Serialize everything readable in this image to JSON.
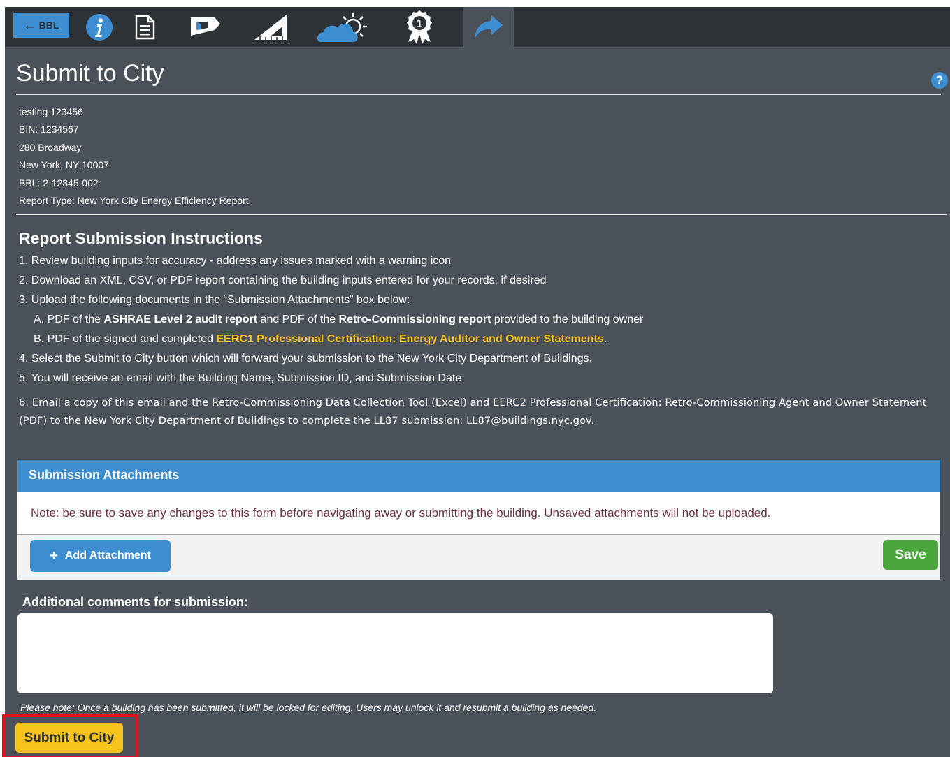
{
  "nav": {
    "back_label": "BBL",
    "icons": [
      "info-icon",
      "document-icon",
      "building-icon",
      "ruler-icon",
      "weather-icon",
      "award-icon",
      "share-icon"
    ],
    "accent_color": "#3d8ed1"
  },
  "page": {
    "title": "Submit to City",
    "help_glyph": "?"
  },
  "building": {
    "name": "testing 123456",
    "bin": "BIN: 1234567",
    "street": "280 Broadway",
    "city": "New York, NY 10007",
    "bbl": "BBL: 2-12345-002",
    "report_type": "Report Type: New York City Energy Efficiency Report"
  },
  "instructions": {
    "title": "Report Submission Instructions",
    "step1": "1. Review building inputs for accuracy -  address any issues marked with a warning icon",
    "step2": "2. Download an XML, CSV, or PDF report containing the building inputs entered for your records, if desired",
    "step3": "3. Upload the following documents in the “Submission Attachments” box below:",
    "step3a_prefix": "A. PDF of the ",
    "step3a_bold1": "ASHRAE Level 2 audit report",
    "step3a_mid": " and PDF of the ",
    "step3a_bold2": "Retro-Commissioning report",
    "step3a_suffix": " provided to the building owner",
    "step3b_prefix": "B. PDF of the signed and completed ",
    "step3b_link": "EERC1 Professional Certification: Energy Auditor and Owner Statements",
    "step3b_suffix": ".",
    "step4": "4. Select the Submit to City button which will forward your submission to the New York City Department of Buildings.",
    "step5": "5. You will receive an email with the Building Name, Submission ID, and Submission Date.",
    "step6": "6. Email a copy of this email and the Retro-Commissioning Data Collection Tool (Excel) and EERC2 Professional Certification: Retro-Commissioning Agent and Owner Statement (PDF) to the New York City Department of Buildings to complete the LL87 submission: LL87@buildings.nyc.gov."
  },
  "attachments": {
    "header": "Submission Attachments",
    "note": "Note: be sure to save any changes to this form before navigating away or submitting the building. Unsaved attachments will not be uploaded.",
    "add_label": "Add Attachment",
    "save_label": "Save"
  },
  "comments": {
    "label": "Additional comments for submission:",
    "value": ""
  },
  "footer": {
    "lock_note": "Please note: Once a building has been submitted, it will be locked for editing. Users may unlock it and resubmit a building as needed.",
    "submit_label": "Submit to City"
  }
}
